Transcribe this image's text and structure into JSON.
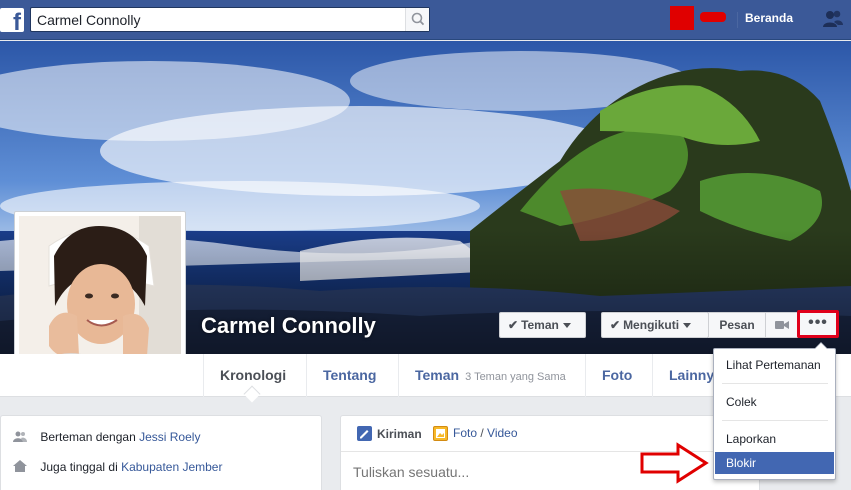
{
  "topbar": {
    "logo": "f",
    "search_value": "Carmel Connolly",
    "home_label": "Beranda"
  },
  "profile": {
    "name": "Carmel Connolly"
  },
  "cover_buttons": {
    "friends": "Teman",
    "following": "Mengikuti",
    "message": "Pesan",
    "more": "•••"
  },
  "nav": {
    "timeline": "Kronologi",
    "about": "Tentang",
    "friends": "Teman",
    "friends_sub": "3 Teman yang Sama",
    "photos": "Foto",
    "more": "Lainny"
  },
  "intro": {
    "friends_with_prefix": "Berteman dengan",
    "friends_with_name": "Jessi Roely",
    "lives_in_prefix": "Juga tinggal di",
    "lives_in_place": "Kabupaten Jember"
  },
  "composer": {
    "post_tab": "Kiriman",
    "photo_tab": "Foto",
    "photo_sep": " / ",
    "video_tab": "Video",
    "placeholder": "Tuliskan sesuatu..."
  },
  "dropdown": {
    "items": [
      "Lihat Pertemanan",
      "Colek",
      "Laporkan",
      "Blokir"
    ]
  },
  "colors": {
    "brand": "#3b5998",
    "highlight": "#4267b2",
    "annotation_red": "#e00000"
  }
}
